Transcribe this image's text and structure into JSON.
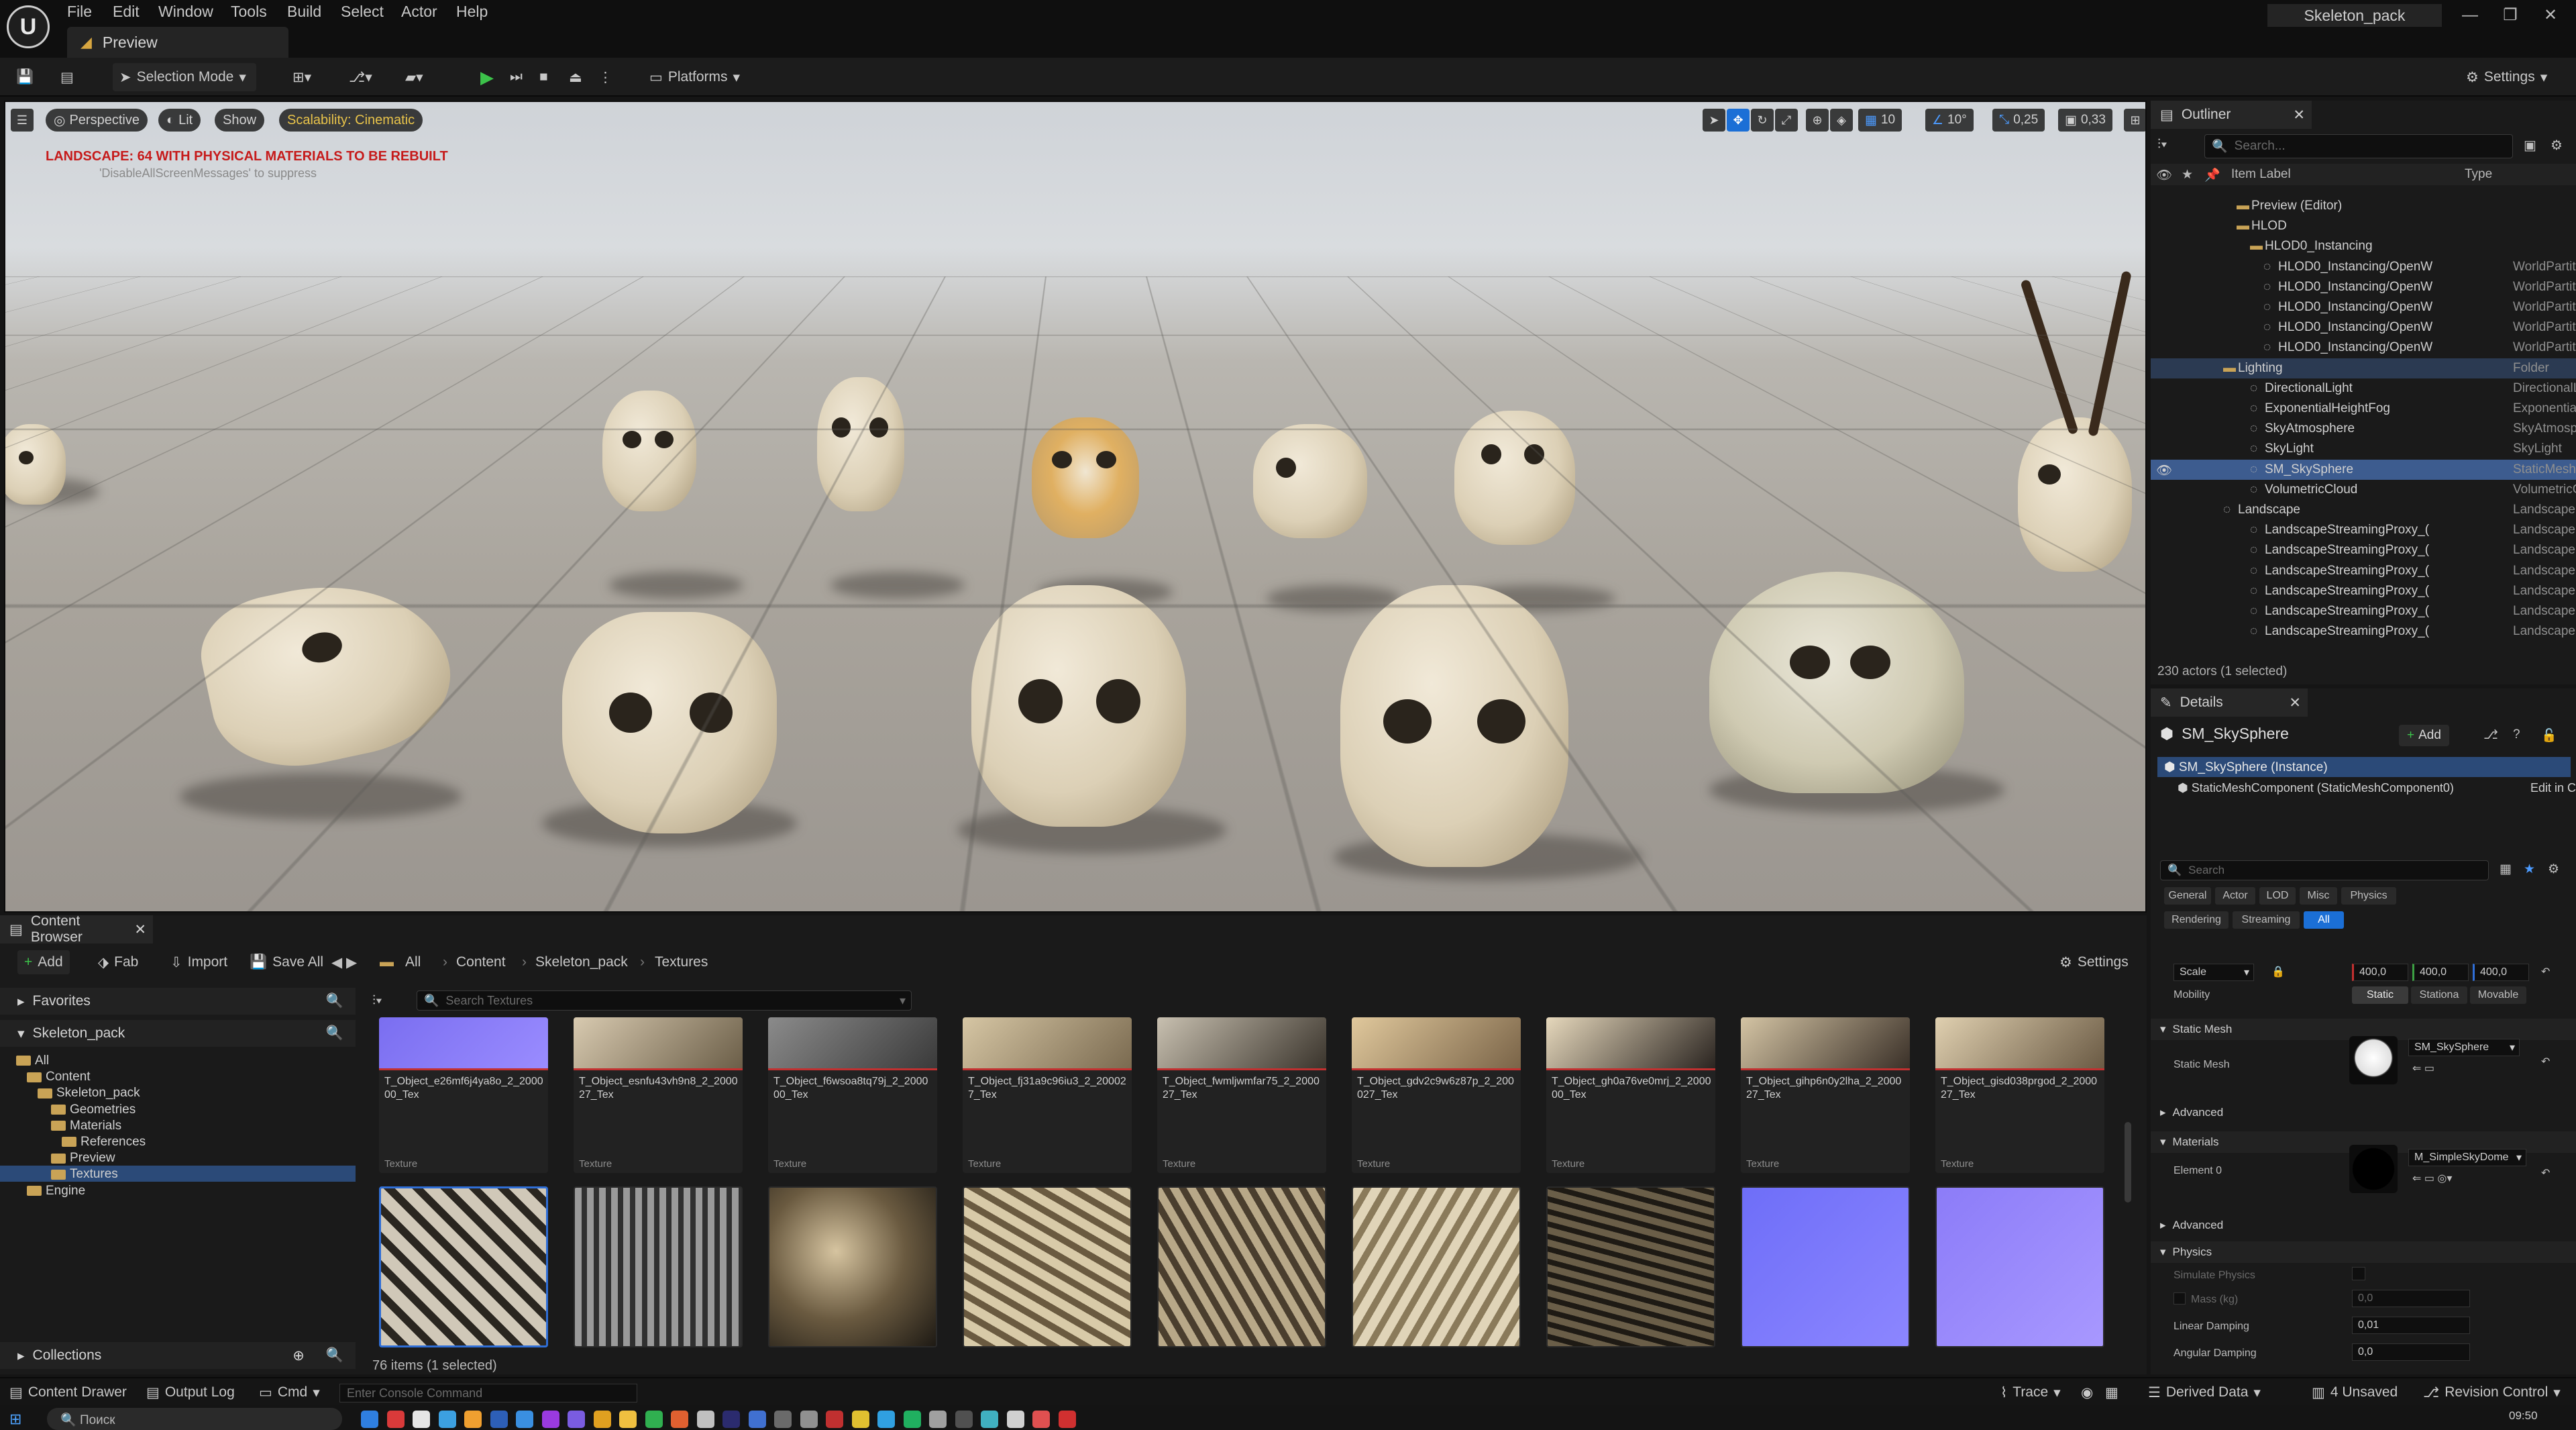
{
  "menu": [
    "File",
    "Edit",
    "Window",
    "Tools",
    "Build",
    "Select",
    "Actor",
    "Help"
  ],
  "tab": "Preview",
  "project": "Skeleton_pack",
  "toolbar": {
    "mode": "Selection Mode",
    "platforms": "Platforms",
    "settings": "Settings"
  },
  "viewport": {
    "perspective": "Perspective",
    "lit": "Lit",
    "show": "Show",
    "scalability": "Scalability: Cinematic",
    "warning": "LANDSCAPE: 64  WITH PHYSICAL MATERIALS  TO BE REBUILT",
    "suppress": "'DisableAllScreenMessages' to suppress",
    "grid": "10",
    "angle": "10°",
    "scale": "0,25",
    "camera": "0,33"
  },
  "outliner": {
    "title": "Outliner",
    "search": "Search...",
    "col_label": "Item Label",
    "col_type": "Type",
    "count": "230 actors (1 selected)",
    "rows": [
      {
        "label": "Preview (Editor)",
        "type": ""
      },
      {
        "label": "HLOD",
        "type": ""
      },
      {
        "label": "HLOD0_Instancing",
        "type": ""
      },
      {
        "label": "HLOD0_Instancing/OpenW",
        "type": "WorldPartition"
      },
      {
        "label": "HLOD0_Instancing/OpenW",
        "type": "WorldPartition"
      },
      {
        "label": "HLOD0_Instancing/OpenW",
        "type": "WorldPartition"
      },
      {
        "label": "HLOD0_Instancing/OpenW",
        "type": "WorldPartition"
      },
      {
        "label": "HLOD0_Instancing/OpenW",
        "type": "WorldPartition"
      },
      {
        "label": "Lighting",
        "type": "Folder"
      },
      {
        "label": "DirectionalLight",
        "type": "DirectionalLigh"
      },
      {
        "label": "ExponentialHeightFog",
        "type": "ExponentialHei"
      },
      {
        "label": "SkyAtmosphere",
        "type": "SkyAtmosphere"
      },
      {
        "label": "SkyLight",
        "type": "SkyLight"
      },
      {
        "label": "SM_SkySphere",
        "type": "StaticMeshAct"
      },
      {
        "label": "VolumetricCloud",
        "type": "VolumetricClou"
      },
      {
        "label": "Landscape",
        "type": "Landscape"
      },
      {
        "label": "LandscapeStreamingProxy_(",
        "type": "LandscapeStre"
      },
      {
        "label": "LandscapeStreamingProxy_(",
        "type": "LandscapeStre"
      },
      {
        "label": "LandscapeStreamingProxy_(",
        "type": "LandscapeStre"
      },
      {
        "label": "LandscapeStreamingProxy_(",
        "type": "LandscapeStre"
      },
      {
        "label": "LandscapeStreamingProxy_(",
        "type": "LandscapeStre"
      },
      {
        "label": "LandscapeStreamingProxy_(",
        "type": "LandscapeStre"
      }
    ]
  },
  "details": {
    "title": "Details",
    "actor": "SM_SkySphere",
    "add": "Add",
    "instance": "SM_SkySphere (Instance)",
    "component": "StaticMeshComponent (StaticMeshComponent0)",
    "edit_in": "Edit in C+",
    "search": "Search",
    "filters": [
      "General",
      "Actor",
      "LOD",
      "Misc",
      "Physics",
      "Rendering",
      "Streaming",
      "All"
    ],
    "scale_label": "Scale",
    "scale": [
      "400,0",
      "400,0",
      "400,0"
    ],
    "mobility": "Mobility",
    "mobility_opts": [
      "Static",
      "Stationa",
      "Movable"
    ],
    "sec_static_mesh": "Static Mesh",
    "static_mesh_label": "Static Mesh",
    "static_mesh_value": "SM_SkySphere",
    "advanced": "Advanced",
    "sec_materials": "Materials",
    "element0": "Element 0",
    "material_value": "M_SimpleSkyDome",
    "sec_physics": "Physics",
    "simulate": "Simulate Physics",
    "mass": "Mass (kg)",
    "mass_value": "0,0",
    "linear": "Linear Damping",
    "linear_value": "0,01",
    "angular": "Angular Damping",
    "angular_value": "0,0"
  },
  "content_browser": {
    "title": "Content Browser",
    "add": "Add",
    "fab": "Fab",
    "import": "Import",
    "save_all": "Save All",
    "settings": "Settings",
    "breadcrumb": [
      "All",
      "Content",
      "Skeleton_pack",
      "Textures"
    ],
    "favorites": "Favorites",
    "root": "Skeleton_pack",
    "search": "Search Textures",
    "collections": "Collections",
    "count": "76 items (1 selected)",
    "tree": [
      "All",
      "Content",
      "Skeleton_pack",
      "Geometries",
      "Materials",
      "References",
      "Preview",
      "Textures",
      "Engine"
    ],
    "assets": [
      {
        "name": "T_Object_e26mf6j4ya8o_2_200000_Tex",
        "type": "Texture"
      },
      {
        "name": "T_Object_esnfu43vh9n8_2_200027_Tex",
        "type": "Texture"
      },
      {
        "name": "T_Object_f6wsoa8tq79j_2_200000_Tex",
        "type": "Texture"
      },
      {
        "name": "T_Object_fj31a9c96iu3_2_200027_Tex",
        "type": "Texture"
      },
      {
        "name": "T_Object_fwmljwmfar75_2_200027_Tex",
        "type": "Texture"
      },
      {
        "name": "T_Object_gdv2c9w6z87p_2_200027_Tex",
        "type": "Texture"
      },
      {
        "name": "T_Object_gh0a76ve0mrj_2_200000_Tex",
        "type": "Texture"
      },
      {
        "name": "T_Object_gihp6n0y2lha_2_200027_Tex",
        "type": "Texture"
      },
      {
        "name": "T_Object_gisd038prgod_2_200027_Tex",
        "type": "Texture"
      }
    ]
  },
  "status": {
    "drawer": "Content Drawer",
    "output": "Output Log",
    "cmd": "Cmd",
    "console": "Enter Console Command",
    "trace": "Trace",
    "derived": "Derived Data",
    "unsaved": "4 Unsaved",
    "revision": "Revision Control"
  },
  "taskbar": {
    "search": "Поиск",
    "time": "09:50"
  }
}
